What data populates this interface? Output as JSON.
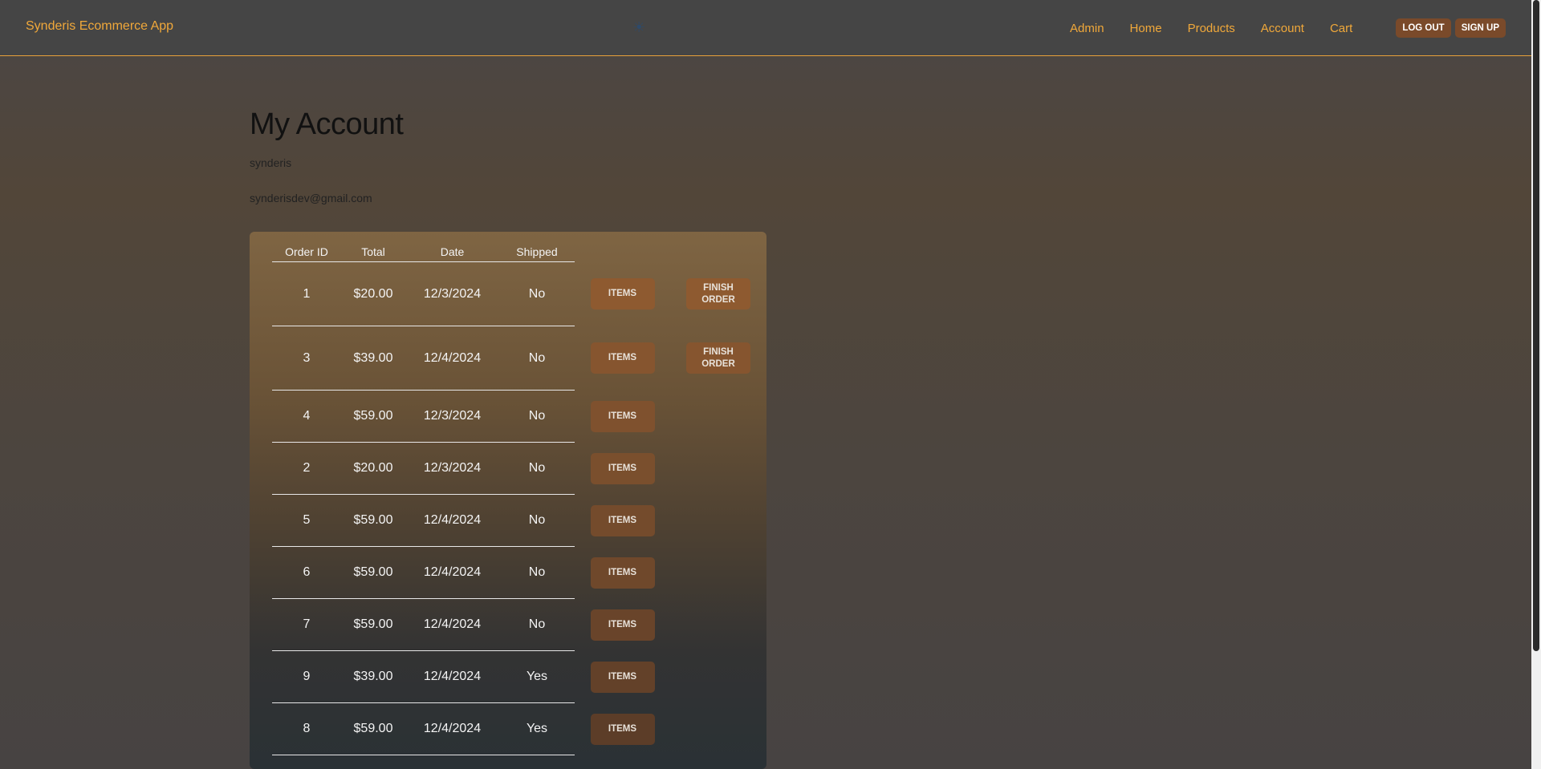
{
  "navbar": {
    "brand": "Synderis Ecommerce App",
    "logo_icon": "sun-icon",
    "links": [
      "Admin",
      "Home",
      "Products",
      "Account",
      "Cart"
    ],
    "buttons": [
      "Log out",
      "Sign up"
    ],
    "accent_color": "#f0a83a"
  },
  "account": {
    "title": "My Account",
    "username": "synderis",
    "email": "synderisdev@gmail.com"
  },
  "orders": {
    "headers": [
      "Order ID",
      "Total",
      "Date",
      "Shipped"
    ],
    "items_button_label": "Items",
    "finish_button_label": "Finish Order",
    "button_colors": [
      "#8e5a30",
      "#86552f",
      "#7f512e",
      "#7a4f2d",
      "#744b2c",
      "#6f482b",
      "#69442a",
      "#634129",
      "#5c3d28"
    ],
    "rows": [
      {
        "id": "1",
        "total": "$20.00",
        "date": "12/3/2024",
        "shipped": "No",
        "finish": true
      },
      {
        "id": "3",
        "total": "$39.00",
        "date": "12/4/2024",
        "shipped": "No",
        "finish": true
      },
      {
        "id": "4",
        "total": "$59.00",
        "date": "12/3/2024",
        "shipped": "No",
        "finish": false
      },
      {
        "id": "2",
        "total": "$20.00",
        "date": "12/3/2024",
        "shipped": "No",
        "finish": false
      },
      {
        "id": "5",
        "total": "$59.00",
        "date": "12/4/2024",
        "shipped": "No",
        "finish": false
      },
      {
        "id": "6",
        "total": "$59.00",
        "date": "12/4/2024",
        "shipped": "No",
        "finish": false
      },
      {
        "id": "7",
        "total": "$59.00",
        "date": "12/4/2024",
        "shipped": "No",
        "finish": false
      },
      {
        "id": "9",
        "total": "$39.00",
        "date": "12/4/2024",
        "shipped": "Yes",
        "finish": false
      },
      {
        "id": "8",
        "total": "$59.00",
        "date": "12/4/2024",
        "shipped": "Yes",
        "finish": false
      }
    ]
  }
}
